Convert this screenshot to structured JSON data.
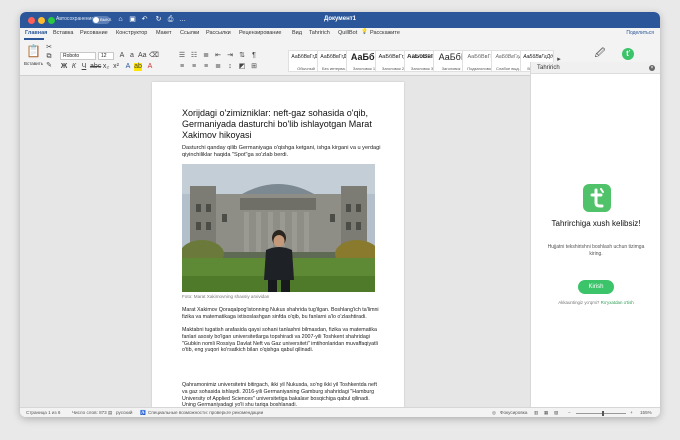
{
  "window": {
    "title": "Документ1",
    "autosave_label": "Автосохранение",
    "autosave_state": "ВЫКЛ."
  },
  "tabs": [
    {
      "label": "Главная",
      "active": true
    },
    {
      "label": "Вставка"
    },
    {
      "label": "Рисование"
    },
    {
      "label": "Конструктор"
    },
    {
      "label": "Макет"
    },
    {
      "label": "Ссылки"
    },
    {
      "label": "Рассылки"
    },
    {
      "label": "Рецензирование"
    },
    {
      "label": "Вид"
    },
    {
      "label": "Tahririch"
    },
    {
      "label": "QuillBot"
    },
    {
      "label": "Расскажите"
    }
  ],
  "share_label": "Поделиться",
  "ribbon": {
    "paste_label": "Вставить",
    "font_name": "Roboto",
    "font_size": "12",
    "styles": [
      {
        "sample": "АаБбВвГгДд",
        "name": "Обычный"
      },
      {
        "sample": "АаБбВвГгДд",
        "name": "Без интерва..."
      },
      {
        "sample": "АаБбI",
        "name": "Заголовок 1"
      },
      {
        "sample": "АаБбВвГгД",
        "name": "Заголовок 2"
      },
      {
        "sample": "АаБбВвГг",
        "name": "Заголовок 3"
      },
      {
        "sample": "АаБбІ",
        "name": "Заголовок"
      },
      {
        "sample": "АаБбВвГг",
        "name": "Подзаголовок"
      },
      {
        "sample": "АаБбВвГгД",
        "name": "Слабое выд..."
      },
      {
        "sample": "АаБбВвГгДд",
        "name": "Выделение"
      }
    ],
    "styles_pane_label": "Панель стилей",
    "tahririch_label": "Tahririch ochish"
  },
  "document": {
    "title": "Xorijdagi o'zimizniklar: neft-gaz sohasida o'qib, Germaniyada dasturchi bo'lib ishlayotgan Marat Xakimov hikoyasi",
    "lead": "Dasturchi qanday qilib Germaniyaga o'qishga ketgani, ishga kirgani va u yerdagi qiyinchiliklar haqida \"Spot\"ga so'zlab berdi.",
    "caption": "Foto: Marat Xakimovning shaxsiy arxividan",
    "paragraphs": [
      "Marat Xakimov Qoraqalpog'istonning Nukus shahrida tug'ilgan. Boshlang'ich ta'limni fizika va matematikaga ixtisoslashgan sinfda o'qib, bu fanlarni a'lo o'zlashtiradi.",
      "Maktabni tugatish arafasida qaysi sohani tanlashni bilmasdan, fizika va matematika fanlari asosiy bo'lgan universitetlarga topshiradi va 2007-yili Toshkent shahridagi \"Gubkin nomli Rossiya Davlat Neft va Gaz universiteti\" imtihonlaridan muvaffaqiyatli o'tib, eng yuqori ko'rsatkich bilan o'qishga qabul qilinadi.",
      "Qahramonimiz universitetni bitirgach, ikki yil Nukusda, so'ng ikki yil Toshkentda neft va gaz sohasida ishlaydi. 2016-yili Germaniyaning Gamburg shahridagi \"Hamburg University of Applied Sciences\" universitetiga bakalavr bosqichiga qabul qilinadi. Uning Germaniyadagi yo'li shu tariqa boshlanadi."
    ]
  },
  "panel": {
    "title": "Tahririch",
    "welcome": "Tahrirchiga xush kelibsiz!",
    "hint": "Hujjatni tekshirishni boshlash uchun tizimga kiring.",
    "login_label": "Kirish",
    "account_text": "Akkauntingiz yo'qmi?",
    "register_link": "Ro'yxatdan o'tish"
  },
  "status": {
    "page": "Страница 1 из 6",
    "words": "Число слов: 873",
    "language": "русский",
    "accessibility": "Специальные возможности: проверьте рекомендации",
    "focus": "Фокусировка",
    "zoom": "155%",
    "zoom_fraction": 0.55
  },
  "colors": {
    "accent": "#2b579a",
    "brand_green": "#3cc46a"
  }
}
